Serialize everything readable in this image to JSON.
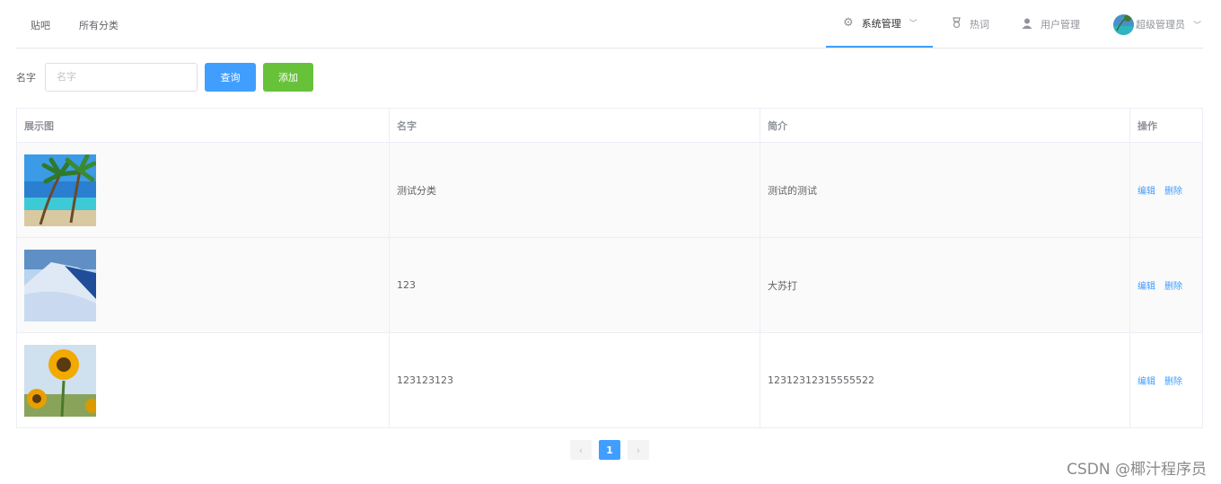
{
  "nav": {
    "left": [
      "贴吧",
      "所有分类"
    ],
    "system": "系统管理",
    "hot": "热词",
    "users": "用户管理",
    "admin": "超级管理员"
  },
  "search": {
    "label": "名字",
    "placeholder": "名字",
    "query_label": "查询",
    "add_label": "添加"
  },
  "table": {
    "columns": [
      "展示图",
      "名字",
      "简介",
      "操作"
    ],
    "rows": [
      {
        "name": "测试分类",
        "intro": "测试的测试",
        "edit": "编辑",
        "delete": "删除",
        "image": "palm-beach"
      },
      {
        "name": "123",
        "intro": "大苏打",
        "edit": "编辑",
        "delete": "删除",
        "image": "snow-mountain"
      },
      {
        "name": "123123123",
        "intro": "12312312315555522",
        "edit": "编辑",
        "delete": "删除",
        "image": "sunflower"
      }
    ]
  },
  "pagination": {
    "prev": "‹",
    "current": "1",
    "next": "›"
  },
  "watermark": "CSDN @椰汁程序员",
  "colors": {
    "primary": "#409eff",
    "success": "#67c23a",
    "border": "#ebeef5"
  }
}
